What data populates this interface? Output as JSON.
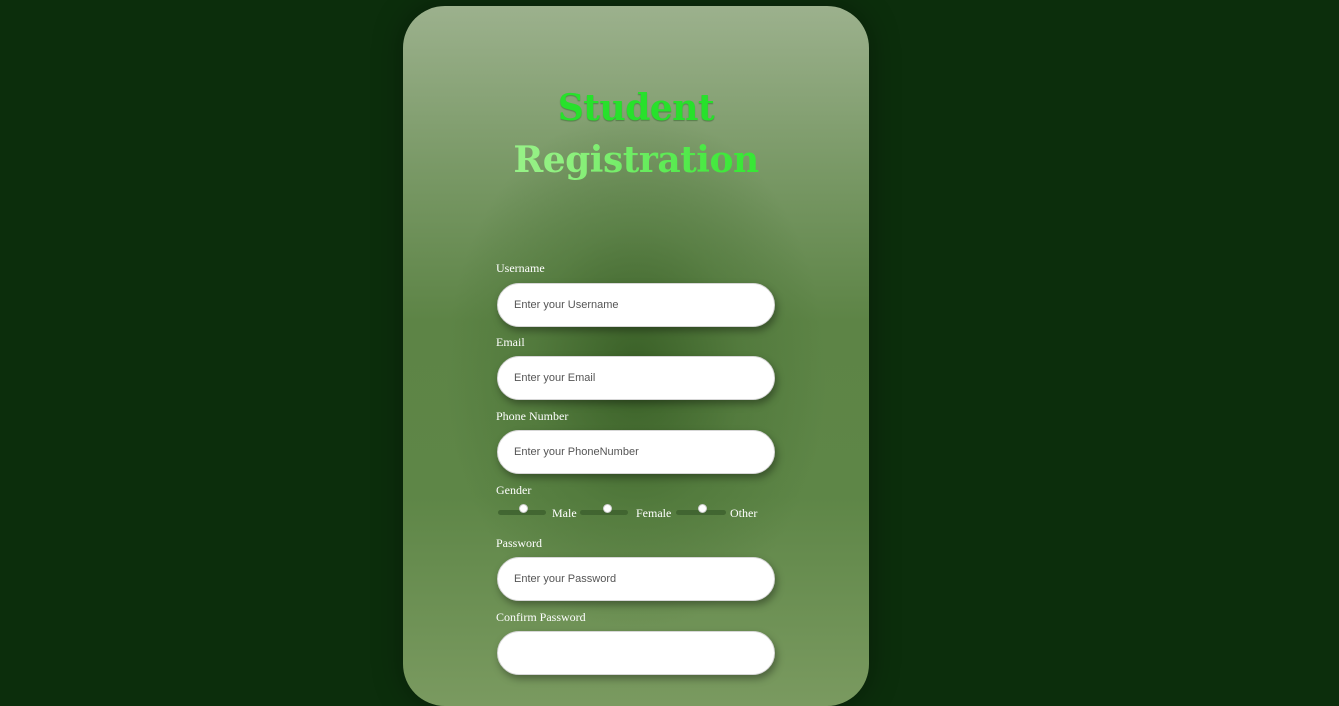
{
  "form": {
    "title_line1": "Student",
    "title_line2": "Registration",
    "fields": {
      "username": {
        "label": "Username",
        "placeholder": "Enter your Username",
        "value": ""
      },
      "email": {
        "label": "Email",
        "placeholder": "Enter your Email",
        "value": ""
      },
      "phone": {
        "label": "Phone Number",
        "placeholder": "Enter your PhoneNumber",
        "value": ""
      },
      "password": {
        "label": "Password",
        "placeholder": "Enter your Password",
        "value": ""
      },
      "confirm_password": {
        "label": "Confirm Password",
        "placeholder": "",
        "value": ""
      }
    },
    "gender": {
      "label": "Gender",
      "options": [
        "Male",
        "Female",
        "Other"
      ],
      "selected": ""
    }
  },
  "colors": {
    "page_background": "#0c2e0c",
    "title_green": "#27e12b",
    "title_light_green": "#a8f49a",
    "label_text": "#ffffff"
  }
}
